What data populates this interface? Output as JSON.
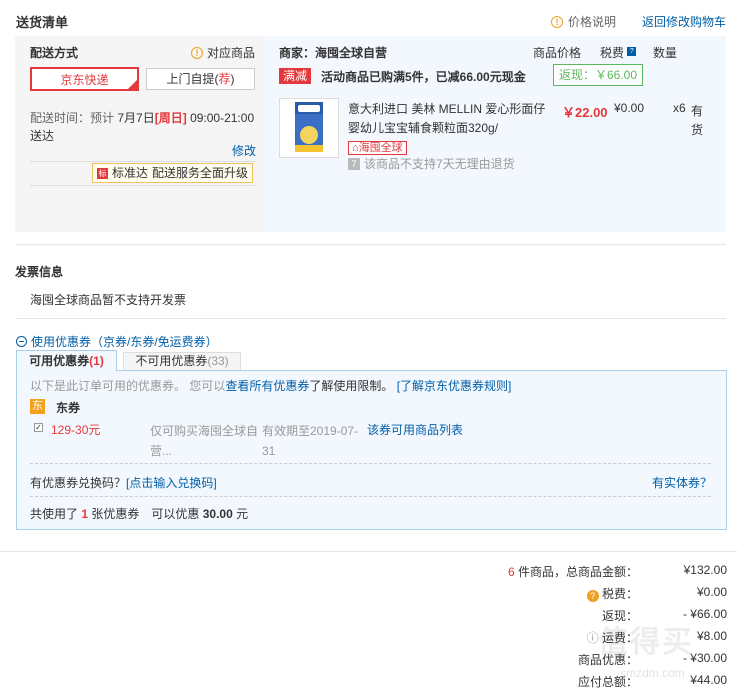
{
  "header": {
    "title": "送货清单",
    "price_explain": "价格说明",
    "back_to_cart": "返回修改购物车"
  },
  "shipping": {
    "method_label": "配送方式",
    "match_goods": "对应商品",
    "option_jd": "京东快递",
    "option_pickup_prefix": "上门自提(",
    "option_pickup_flag": "荐",
    "option_pickup_suffix": ")",
    "time_prefix": "配送时间：预计",
    "time_date": "7月7日",
    "time_day": "[周日]",
    "time_range": "09:00-21:00 送达",
    "modify": "修改",
    "service_tag_icon": "标",
    "service_tag_name": "标准达",
    "service_tag_text": "配送服务全面升级"
  },
  "order": {
    "seller_label": "商家：",
    "seller_name": "海囤全球自营",
    "col_price": "商品价格",
    "col_tax": "税费",
    "col_qty": "数量",
    "promo_tag": "满减",
    "promo_text": "活动商品已购满5件，已减66.00元现金",
    "rebate": "返现：￥66.00",
    "product_name": "意大利进口 美林 MELLIN 爱心形面仔婴幼儿宝宝辅食颗粒面320g/",
    "product_tag": "海囤全球",
    "no_return": "该商品不支持7天无理由退货",
    "unit_price": "￥22.00",
    "tax": "¥0.00",
    "qty": "x6",
    "stock": "有货"
  },
  "invoice": {
    "title": "发票信息",
    "text": "海囤全球商品暂不支持开发票"
  },
  "coupons": {
    "toggle": "使用优惠券（京券/东券/免运费券）",
    "tab_usable_label": "可用优惠券",
    "tab_usable_count": "(1)",
    "tab_unusable_label": "不可用优惠券",
    "tab_unusable_count": "(33)",
    "info_prefix": "以下是此订单可用的优惠券。 您可以",
    "info_view_all": "查看所有优惠券",
    "info_suffix": "了解使用限制。",
    "info_rules": "[了解京东优惠券规则]",
    "group_badge": "东",
    "group_label": "东券",
    "item_amount": "129-30元",
    "item_scope": "仅可购买海囤全球自营...",
    "item_expire": "有效期至2019-07-31",
    "item_list_link": "该券可用商品列表",
    "redeem_question": "有优惠券兑换码？",
    "redeem_link": "[点击输入兑换码]",
    "physical_coupon": "有实体券？",
    "summary_prefix": "共使用了",
    "summary_count": "1",
    "summary_mid": "张优惠券　可以优惠",
    "summary_amount": "30.00",
    "summary_unit": "元"
  },
  "totals": {
    "items_count": "6",
    "items_label": "件商品，总商品金额：",
    "items_value": "¥132.00",
    "tax_label": "税费：",
    "tax_value": "¥0.00",
    "rebate_label": "返现：",
    "rebate_value": "- ¥66.00",
    "freight_label": "运费：",
    "freight_value": "¥8.00",
    "discount_label": "商品优惠：",
    "discount_value": "- ¥30.00",
    "payable_label": "应付总额：",
    "payable_value": "¥44.00"
  },
  "watermark": {
    "cn": "值得买",
    "url": "smzdm.com"
  },
  "colors": {
    "accent_red": "#e4393c",
    "link_blue": "#005ea7",
    "rebate_green": "#5cb85c",
    "warn_orange": "#f0a020"
  }
}
